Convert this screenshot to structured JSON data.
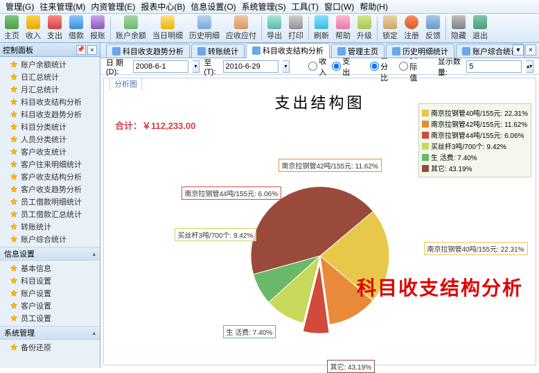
{
  "menu": [
    "管理(G)",
    "往来管理(M)",
    "内资管理(E)",
    "报表中心(B)",
    "信息设置(O)",
    "系统管理(S)",
    "工具(T)",
    "窗口(W)",
    "帮助(H)"
  ],
  "toolbar": [
    {
      "id": "home",
      "label": "主页"
    },
    {
      "id": "in",
      "label": "收入"
    },
    {
      "id": "out",
      "label": "支出"
    },
    {
      "id": "loan",
      "label": "借款"
    },
    {
      "id": "rep",
      "label": "报账"
    },
    {
      "sep": true
    },
    {
      "id": "bal",
      "label": "账户余额"
    },
    {
      "id": "today",
      "label": "当日明细"
    },
    {
      "id": "hist",
      "label": "历史明细"
    },
    {
      "id": "ar",
      "label": "应收应付"
    },
    {
      "sep": true
    },
    {
      "id": "exp",
      "label": "导出"
    },
    {
      "id": "print",
      "label": "打印"
    },
    {
      "sep": true
    },
    {
      "id": "ref",
      "label": "刷新"
    },
    {
      "id": "help",
      "label": "帮助"
    },
    {
      "id": "up",
      "label": "升级"
    },
    {
      "sep": true
    },
    {
      "id": "lock",
      "label": "锁定"
    },
    {
      "id": "reg",
      "label": "注册"
    },
    {
      "id": "fb",
      "label": "反馈"
    },
    {
      "sep": true
    },
    {
      "id": "hide",
      "label": "隐藏"
    },
    {
      "id": "exit",
      "label": "退出"
    }
  ],
  "sidebar_title": "控制面板",
  "sidebar": {
    "sections": [
      {
        "title": "",
        "items": [
          "账户余额统计",
          "日汇总统计",
          "月汇总统计",
          "科目收支结构分析",
          "科目收支趋势分析",
          "科目分类统计",
          "人员分类统计",
          "客户收支统计",
          "客户往来明细统计",
          "客户收支结构分析",
          "客户收支趋势分析",
          "员工借款明细统计",
          "员工借款汇总统计",
          "转账统计",
          "账户综合统计"
        ]
      },
      {
        "title": "信息设置",
        "items": [
          "基本信息",
          "科目设置",
          "账户设置",
          "客户设置",
          "员工设置"
        ]
      },
      {
        "title": "系统管理",
        "items": [
          "备份还原"
        ]
      }
    ]
  },
  "tabs": [
    "科目收支趋势分析",
    "转账统计",
    "科目收支结构分析",
    "管理主页",
    "历史明细统计",
    "账户综合统计"
  ],
  "active_tab": 2,
  "filter": {
    "date_label": "日 期(D):",
    "from": "2008-6-1",
    "to_label": "至(T):",
    "to": "2010-6-29",
    "r_in": "收入",
    "r_out": "支出",
    "r_pct": "百分比",
    "r_val": "实际值",
    "qty_label": "显示数量:",
    "qty": "5"
  },
  "chart_tab": "分析图",
  "chart": {
    "title": "支出结构图",
    "total_label": "合计：",
    "total_value": "￥112,233.00"
  },
  "chart_data": {
    "type": "pie",
    "title": "支出结构图",
    "series": [
      {
        "name": "南京拉钢管40吨/155元",
        "value": 22.31,
        "color": "#e8c84a"
      },
      {
        "name": "南京拉钢管42吨/155元",
        "value": 11.62,
        "color": "#e88a3a"
      },
      {
        "name": "南京拉钢管44吨/155元",
        "value": 6.06,
        "color": "#d14a3a"
      },
      {
        "name": "买丝杆3吨/700个",
        "value": 9.42,
        "color": "#c8d85a"
      },
      {
        "name": "生 活费",
        "value": 7.4,
        "color": "#6ab86a"
      },
      {
        "name": "其它",
        "value": 43.19,
        "color": "#9a4a3a"
      }
    ]
  },
  "overlay": "科目收支结构分析"
}
